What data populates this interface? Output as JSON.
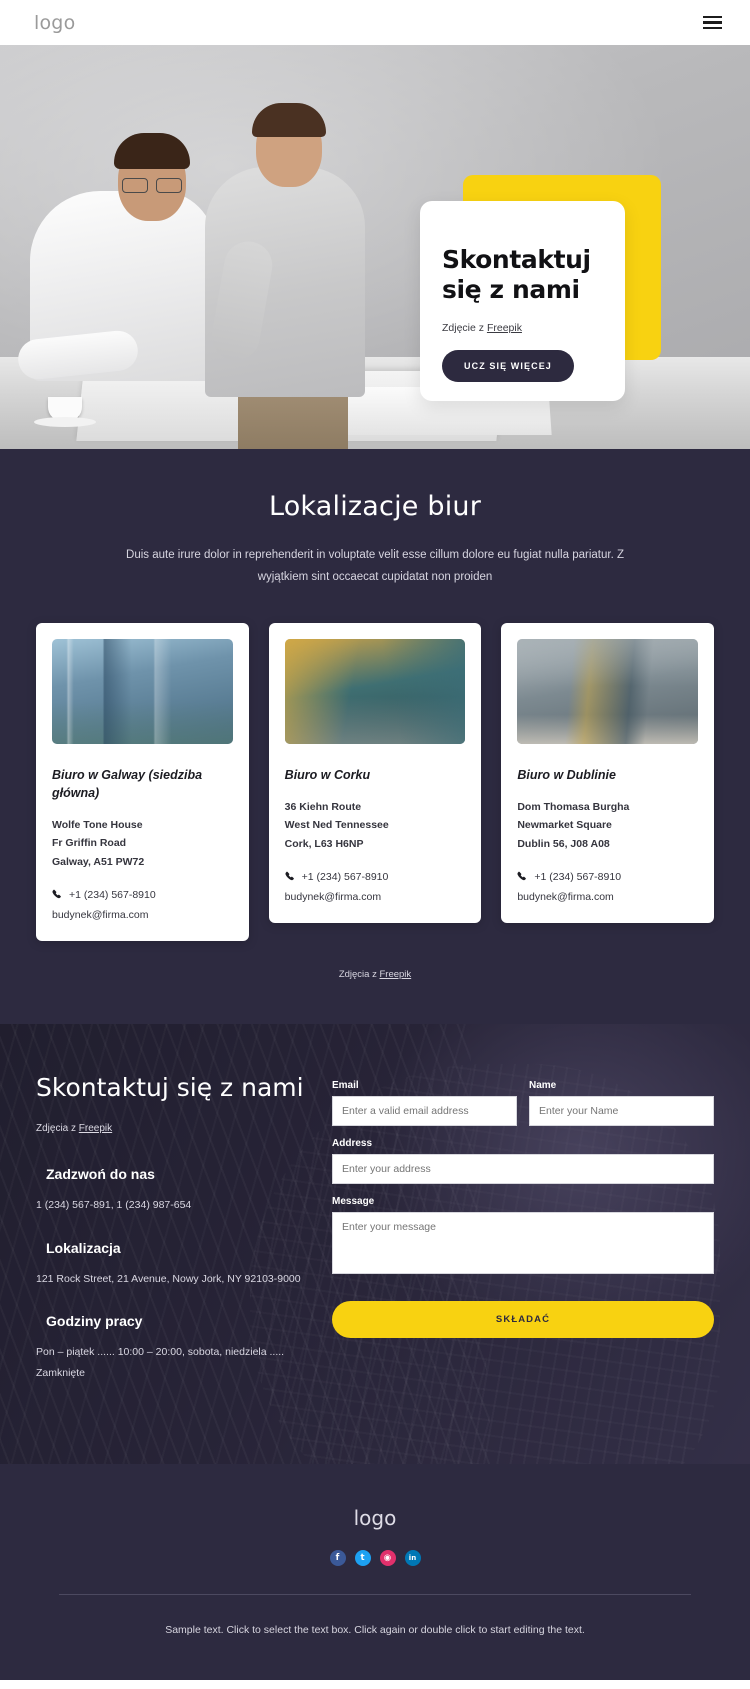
{
  "header": {
    "logo": "logo",
    "menu_icon": "hamburger-icon"
  },
  "hero": {
    "title": "Skontaktuj się z nami",
    "credit_prefix": "Zdjęcie z ",
    "credit_link": "Freepik",
    "cta": "UCZ SIĘ WIĘCEJ"
  },
  "locations": {
    "title": "Lokalizacje biur",
    "subtitle": "Duis aute irure dolor in reprehenderit in voluptate velit esse cillum dolore eu fugiat nulla pariatur. Z wyjątkiem sint occaecat cupidatat non proiden",
    "credit_prefix": "Zdjęcia z ",
    "credit_link": "Freepik",
    "cards": [
      {
        "title": "Biuro w Galway (siedziba główna)",
        "line1": "Wolfe Tone House",
        "line2": "Fr Griffin Road",
        "line3": "Galway, A51 PW72",
        "phone": "+1 (234) 567-8910",
        "email": "budynek@firma.com"
      },
      {
        "title": "Biuro w Corku",
        "line1": "36 Kiehn Route",
        "line2": "West Ned Tennessee",
        "line3": "Cork, L63 H6NP",
        "phone": "+1 (234) 567-8910",
        "email": "budynek@firma.com"
      },
      {
        "title": "Biuro w Dublinie",
        "line1": "Dom Thomasa Burgha",
        "line2": "Newmarket Square",
        "line3": "Dublin 56, J08 A08",
        "phone": "+1 (234) 567-8910",
        "email": "budynek@firma.com"
      }
    ]
  },
  "contact": {
    "title": "Skontaktuj się z nami",
    "credit_prefix": "Zdjęcia z ",
    "credit_link": "Freepik",
    "blocks": [
      {
        "heading": "Zadzwoń do nas",
        "text": "1 (234) 567-891, 1 (234) 987-654"
      },
      {
        "heading": "Lokalizacja",
        "text": "121 Rock Street, 21 Avenue, Nowy Jork, NY 92103-9000"
      },
      {
        "heading": "Godziny pracy",
        "text": "Pon – piątek ...... 10:00 – 20:00, sobota, niedziela ..... Zamknięte"
      }
    ],
    "form": {
      "email_label": "Email",
      "email_placeholder": "Enter a valid email address",
      "name_label": "Name",
      "name_placeholder": "Enter your Name",
      "address_label": "Address",
      "address_placeholder": "Enter your address",
      "message_label": "Message",
      "message_placeholder": "Enter your message",
      "submit": "SKŁADAĆ"
    }
  },
  "footer": {
    "logo": "logo",
    "socials": [
      {
        "name": "facebook",
        "glyph": "f",
        "color": "#3b5998"
      },
      {
        "name": "twitter",
        "glyph": "t",
        "color": "#1da1f2"
      },
      {
        "name": "instagram",
        "glyph": "◉",
        "color": "#e1306c"
      },
      {
        "name": "linkedin",
        "glyph": "in",
        "color": "#0077b5"
      }
    ],
    "text": "Sample text. Click to select the text box. Click again or double click to start editing the text."
  },
  "colors": {
    "accent_yellow": "#f8d211",
    "dark_purple": "#2d2a40",
    "button_dark": "#2d2a3f"
  }
}
